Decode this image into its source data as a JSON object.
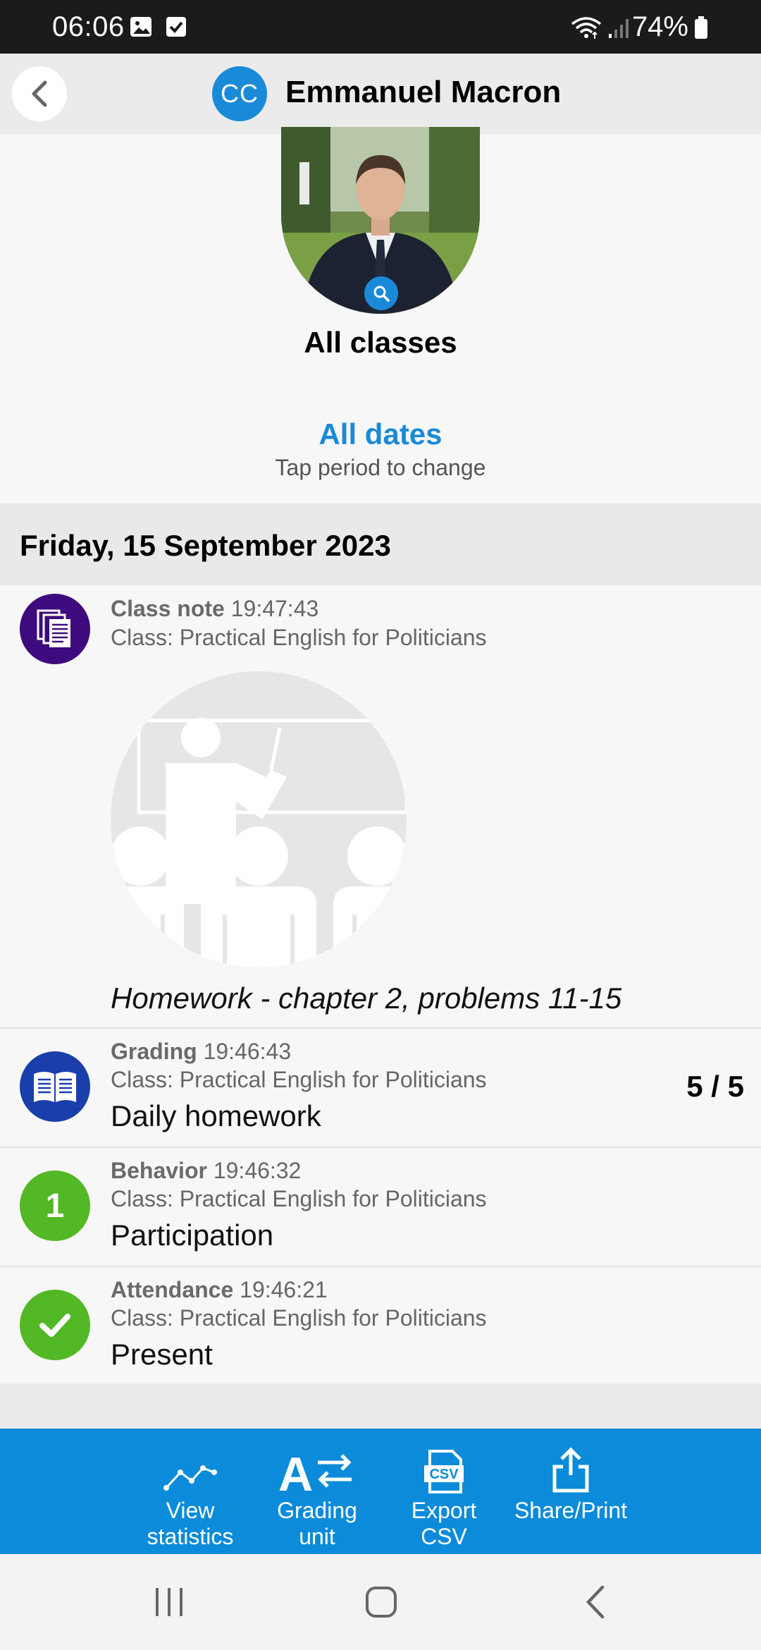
{
  "status_bar": {
    "time": "06:06",
    "battery": "74%",
    "icons": [
      "gallery-icon",
      "checkbox-icon",
      "wifi-icon",
      "signal-icon",
      "battery-icon"
    ]
  },
  "header": {
    "logo_text": "CC",
    "title": "Emmanuel Macron"
  },
  "profile": {
    "class_filter": "All classes",
    "date_filter": "All dates",
    "date_hint": "Tap period to change"
  },
  "day": {
    "date": "Friday, 15 September 2023"
  },
  "entries": [
    {
      "type": "Class note",
      "time": "19:47:43",
      "class": "Class: Practical English for Politicians",
      "text": "Homework - chapter 2, problems 11-15",
      "icon": "notes-icon",
      "color": "#3d0b7d"
    },
    {
      "type": "Grading",
      "time": "19:46:43",
      "class": "Class: Practical English for Politicians",
      "text": "Daily homework",
      "score": "5 / 5",
      "icon": "book-icon",
      "color": "#1a3faa"
    },
    {
      "type": "Behavior",
      "time": "19:46:32",
      "class": "Class: Practical English for Politicians",
      "text": "Participation",
      "badge": "1",
      "icon": "behavior-badge-icon",
      "color": "#52b825"
    },
    {
      "type": "Attendance",
      "time": "19:46:21",
      "class": "Class: Practical English for Politicians",
      "text": "Present",
      "icon": "checkmark-icon",
      "color": "#52b825"
    }
  ],
  "toolbar": {
    "items": [
      {
        "label_line1": "View",
        "label_line2": "statistics",
        "icon": "statistics-icon"
      },
      {
        "label_line1": "Grading",
        "label_line2": "unit",
        "icon": "grading-unit-icon"
      },
      {
        "label_line1": "Export",
        "label_line2": "CSV",
        "icon": "csv-icon"
      },
      {
        "label_line1": "Share/Print",
        "label_line2": "",
        "icon": "share-icon"
      }
    ]
  },
  "colors": {
    "accent": "#1a8ad8",
    "toolbar": "#0b8bd9",
    "statusbar": "#1b1b1b"
  }
}
